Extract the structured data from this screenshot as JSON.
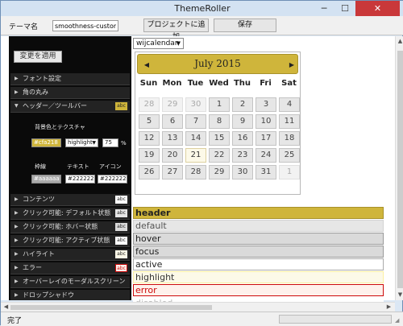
{
  "window": {
    "title": "ThemeRoller",
    "min_icon": "minimize-icon",
    "max_icon": "maximize-icon",
    "close_icon": "close-icon"
  },
  "toolbar": {
    "theme_label": "テーマ名",
    "theme_value": "smoothness-custom",
    "add_label": "プロジェクトに追加",
    "save_label": "保存"
  },
  "panel": {
    "apply_label": "変更を適用",
    "sections": [
      {
        "label": "フォント設定",
        "badge": ""
      },
      {
        "label": "角の丸み",
        "badge": ""
      },
      {
        "label": "ヘッダー／ツールバー",
        "badge": "abc"
      },
      {
        "label": "コンテンツ",
        "badge": "abc"
      },
      {
        "label": "クリック可能: デフォルト状態",
        "badge": "abc"
      },
      {
        "label": "クリック可能: ホバー状態",
        "badge": "abc"
      },
      {
        "label": "クリック可能: アクティブ状態",
        "badge": "abc"
      },
      {
        "label": "ハイライト",
        "badge": "abc"
      },
      {
        "label": "エラー",
        "badge": "abc"
      },
      {
        "label": "オーバーレイのモーダルスクリーン",
        "badge": ""
      },
      {
        "label": "ドロップシャドウ",
        "badge": ""
      }
    ],
    "detail": {
      "bg_label": "背景色とテクスチャ",
      "bg_color": "#cfa218",
      "texture": "highlight",
      "opacity": "75",
      "opacity_unit": "%",
      "border_label": "枠線",
      "text_label": "テキスト",
      "icon_label": "アイコン",
      "border_color": "#aaaaaa",
      "text_color": "#222222",
      "icon_color": "#222222"
    }
  },
  "widget_select": "wijcalendar",
  "calendar": {
    "title": "July 2015",
    "days": [
      "Sun",
      "Mon",
      "Tue",
      "Wed",
      "Thu",
      "Fri",
      "Sat"
    ],
    "cells": [
      "28",
      "29",
      "30",
      "1",
      "2",
      "3",
      "4",
      "5",
      "6",
      "7",
      "8",
      "9",
      "10",
      "11",
      "12",
      "13",
      "14",
      "15",
      "16",
      "17",
      "18",
      "19",
      "20",
      "21",
      "22",
      "23",
      "24",
      "25",
      "26",
      "27",
      "28",
      "29",
      "30",
      "31",
      "1"
    ],
    "other_month_indices": [
      0,
      1,
      2,
      34
    ],
    "today_index": 23
  },
  "states": [
    "header",
    "default",
    "hover",
    "focus",
    "active",
    "highlight",
    "error",
    "disabled"
  ],
  "status": {
    "text": "完了"
  },
  "colors": {
    "header_gold": "#cfb53b",
    "error_red": "#cd0a0a",
    "panel_black": "#0a0a0a"
  }
}
